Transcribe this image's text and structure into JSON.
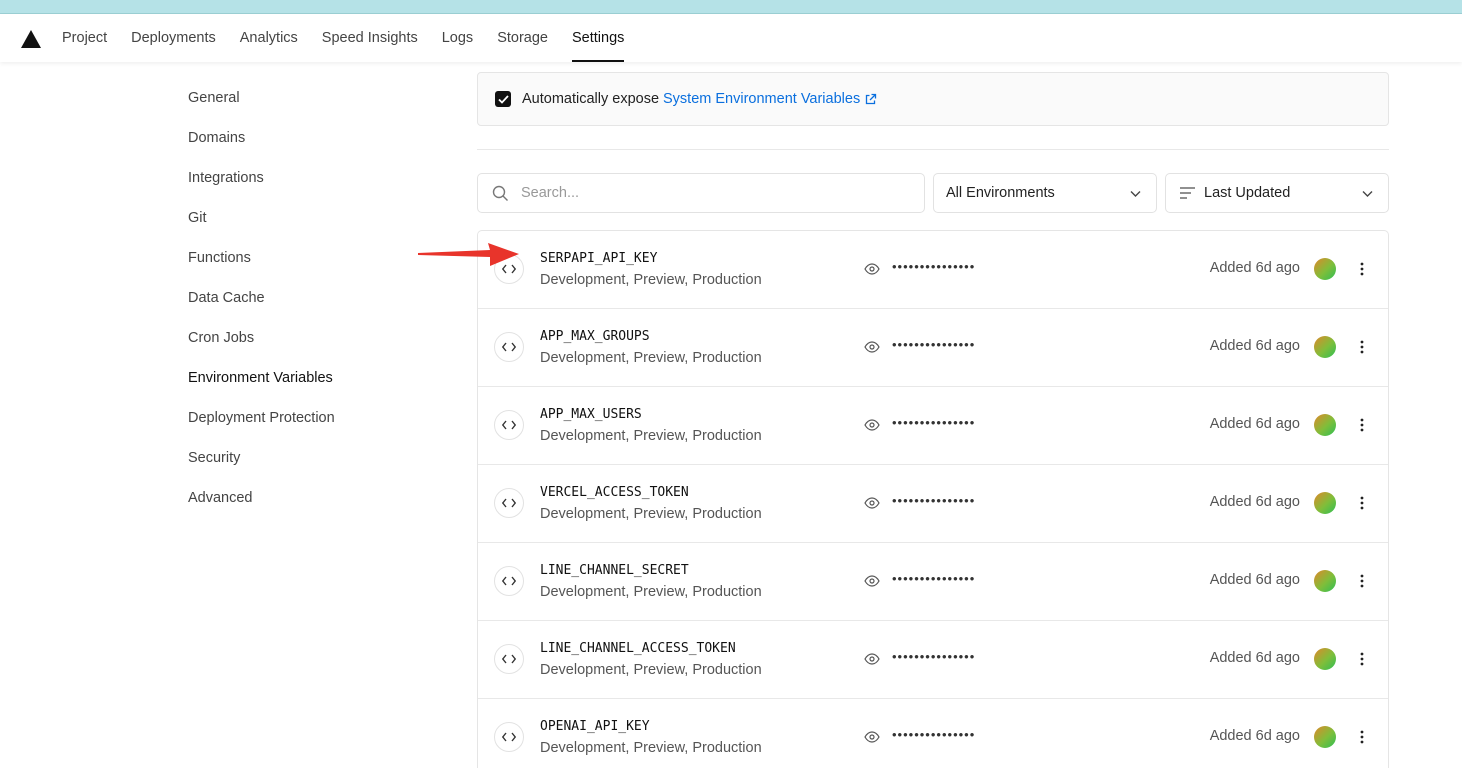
{
  "nav": {
    "tabs": [
      {
        "label": "Project"
      },
      {
        "label": "Deployments"
      },
      {
        "label": "Analytics"
      },
      {
        "label": "Speed Insights"
      },
      {
        "label": "Logs"
      },
      {
        "label": "Storage"
      },
      {
        "label": "Settings",
        "active": true
      }
    ]
  },
  "sidebar": {
    "items": [
      {
        "label": "General"
      },
      {
        "label": "Domains"
      },
      {
        "label": "Integrations"
      },
      {
        "label": "Git"
      },
      {
        "label": "Functions"
      },
      {
        "label": "Data Cache"
      },
      {
        "label": "Cron Jobs"
      },
      {
        "label": "Environment Variables",
        "active": true
      },
      {
        "label": "Deployment Protection"
      },
      {
        "label": "Security"
      },
      {
        "label": "Advanced"
      }
    ]
  },
  "expose": {
    "checked": true,
    "text": "Automatically expose",
    "link": "System Environment Variables"
  },
  "filters": {
    "search_placeholder": "Search...",
    "environment": "All Environments",
    "sort": "Last Updated"
  },
  "env_vars": [
    {
      "name": "SERPAPI_API_KEY",
      "targets": "Development, Preview, Production",
      "value_masked": "•••••••••••••••",
      "added": "Added 6d ago"
    },
    {
      "name": "APP_MAX_GROUPS",
      "targets": "Development, Preview, Production",
      "value_masked": "•••••••••••••••",
      "added": "Added 6d ago"
    },
    {
      "name": "APP_MAX_USERS",
      "targets": "Development, Preview, Production",
      "value_masked": "•••••••••••••••",
      "added": "Added 6d ago"
    },
    {
      "name": "VERCEL_ACCESS_TOKEN",
      "targets": "Development, Preview, Production",
      "value_masked": "•••••••••••••••",
      "added": "Added 6d ago"
    },
    {
      "name": "LINE_CHANNEL_SECRET",
      "targets": "Development, Preview, Production",
      "value_masked": "•••••••••••••••",
      "added": "Added 6d ago"
    },
    {
      "name": "LINE_CHANNEL_ACCESS_TOKEN",
      "targets": "Development, Preview, Production",
      "value_masked": "•••••••••••••••",
      "added": "Added 6d ago"
    },
    {
      "name": "OPENAI_API_KEY",
      "targets": "Development, Preview, Production",
      "value_masked": "•••••••••••••••",
      "added": "Added 6d ago"
    }
  ],
  "colors": {
    "top_strip": "#b5e2e7",
    "link": "#0a6fde",
    "annotation_arrow": "#e8342b"
  },
  "icons": {
    "logo": "vercel-triangle-icon",
    "search": "search-icon",
    "chevron": "chevron-down-icon",
    "sort": "sort-lines-icon",
    "code": "code-brackets-icon",
    "eye": "eye-icon",
    "more": "kebab-menu-icon",
    "external": "external-link-icon",
    "check": "check-icon"
  }
}
